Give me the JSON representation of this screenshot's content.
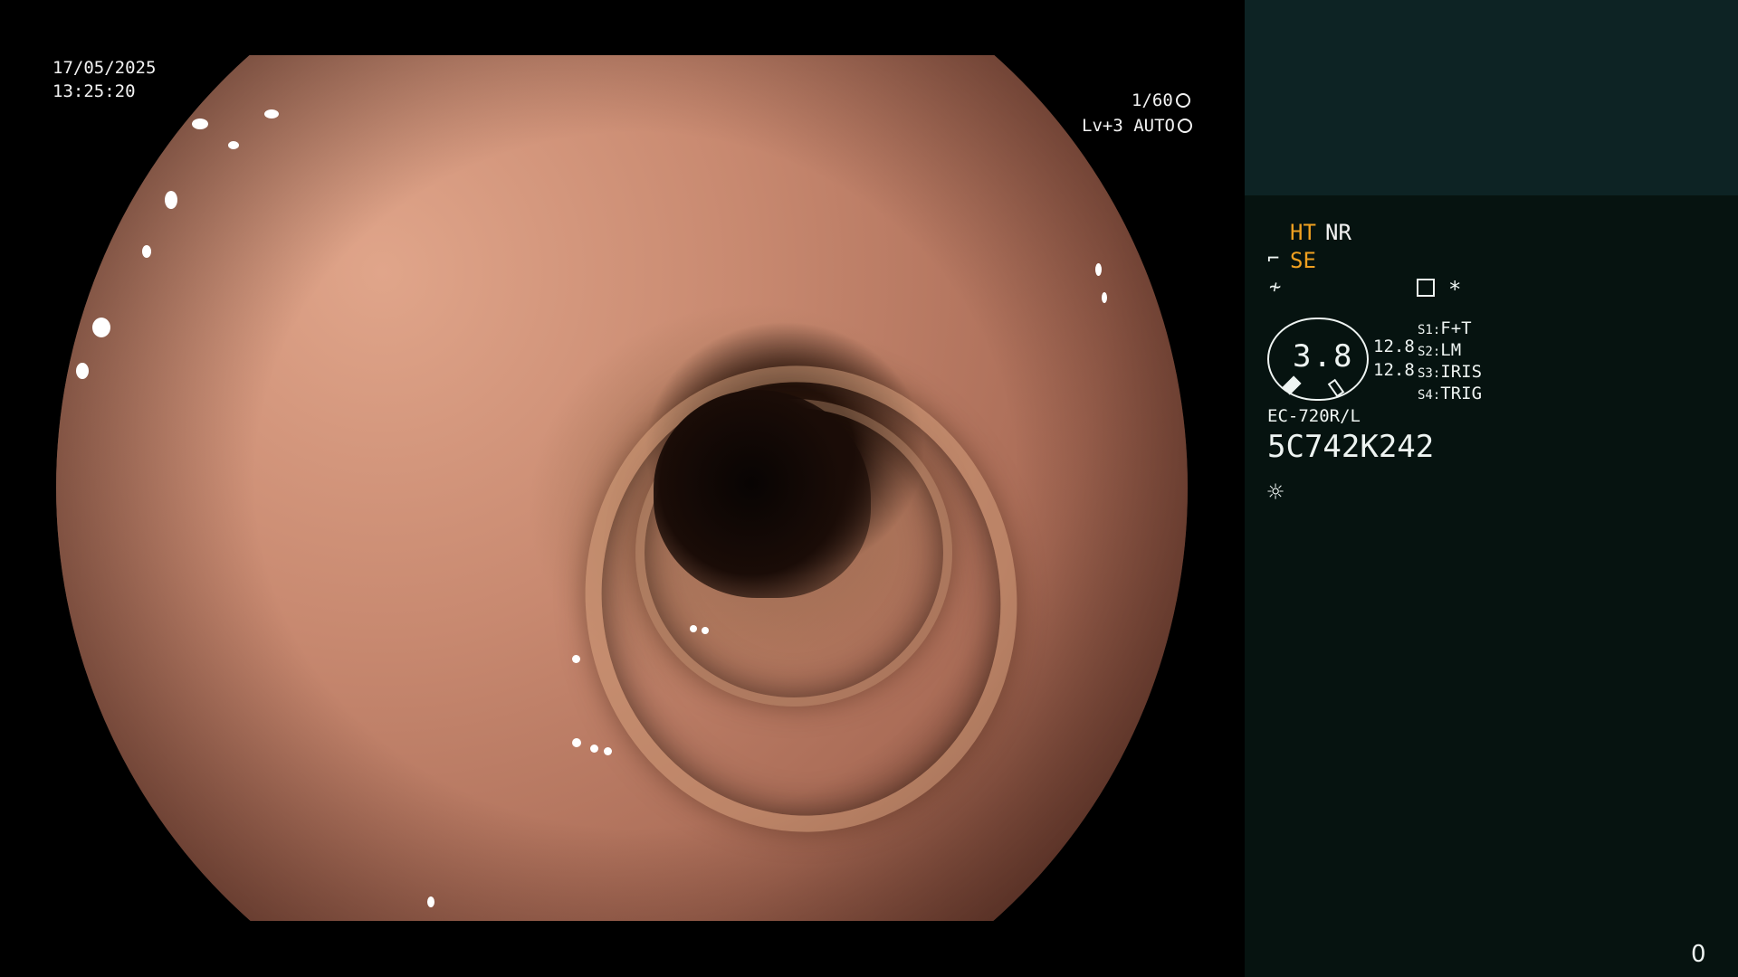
{
  "osd": {
    "date": "17/05/2025",
    "time": "13:25:20",
    "shutter": "1/60",
    "shutter_icon": "aperture-icon",
    "mode": "Lv+3 AUTO",
    "mode_icon": "iris-icon"
  },
  "panel": {
    "colors": {
      "top_bg": "#0d2324",
      "bottom_bg": "#061310",
      "highlight": "#f0a020"
    },
    "line1": {
      "ht": "HT",
      "nr": "NR"
    },
    "line2": {
      "icon": "scope-tip-icon",
      "se": "SE"
    },
    "line3": {
      "icon": "freeze-icon",
      "settings_icon": "menu-list-icon",
      "star": "*"
    },
    "gauge": {
      "value": "3.8",
      "side_values": [
        "12.8",
        "12.8"
      ]
    },
    "switches": [
      {
        "label": "S1:",
        "value": "F+T"
      },
      {
        "label": "S2:",
        "value": "LM"
      },
      {
        "label": "S3:",
        "value": "IRIS"
      },
      {
        "label": "S4:",
        "value": "TRIG"
      }
    ],
    "model": "EC-720R/L",
    "serial": "5C742K242",
    "light_icon": "sun-icon"
  },
  "counter": "0"
}
